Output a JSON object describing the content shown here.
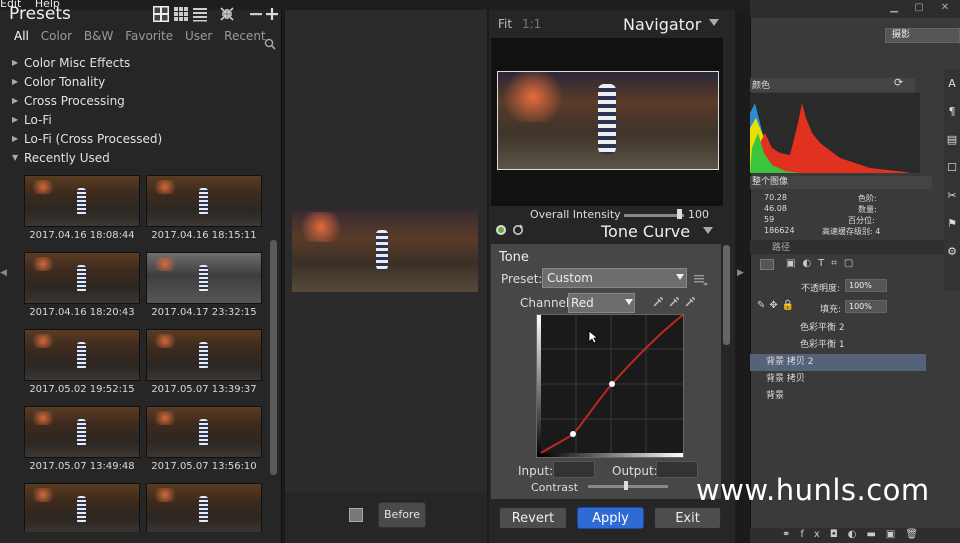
{
  "menu": [
    "Edit",
    "Help"
  ],
  "presets": {
    "title": "Presets",
    "tabs": [
      "All",
      "Color",
      "B&W",
      "Favorite",
      "User",
      "Recent"
    ],
    "groups": [
      {
        "label": "Color Misc Effects",
        "expanded": false
      },
      {
        "label": "Color Tonality",
        "expanded": false
      },
      {
        "label": "Cross Processing",
        "expanded": false
      },
      {
        "label": "Lo-Fi",
        "expanded": false
      },
      {
        "label": "Lo-Fi (Cross Processed)",
        "expanded": false
      },
      {
        "label": "Recently Used",
        "expanded": true
      }
    ],
    "thumbnails": [
      {
        "label": "2017.04.16 18:08:44",
        "bw": false
      },
      {
        "label": "2017.04.16 18:15:11",
        "bw": false
      },
      {
        "label": "2017.04.16 18:20:43",
        "bw": false
      },
      {
        "label": "2017.04.17 23:32:15",
        "bw": true
      },
      {
        "label": "2017.05.02 19:52:15",
        "bw": false
      },
      {
        "label": "2017.05.07 13:39:37",
        "bw": false
      },
      {
        "label": "2017.05.07 13:49:48",
        "bw": false
      },
      {
        "label": "2017.05.07 13:56:10",
        "bw": false
      },
      {
        "label": "",
        "bw": false
      },
      {
        "label": "",
        "bw": false
      }
    ]
  },
  "preview": {
    "before_label": "Before"
  },
  "navigator": {
    "fit": "Fit",
    "one_to_one": "1:1",
    "title": "Navigator"
  },
  "overall_intensity": {
    "label": "Overall Intensity",
    "value": "100"
  },
  "tone_curve": {
    "title": "Tone Curve",
    "section": "Tone",
    "preset_label": "Preset:",
    "preset_value": "Custom",
    "channel_label": "Channel:",
    "channel_value": "Red",
    "input_label": "Input:",
    "output_label": "Output:",
    "contrast_label": "Contrast",
    "curve_color": "#c0281e"
  },
  "footer": {
    "revert": "Revert",
    "apply": "Apply",
    "exit": "Exit"
  },
  "photoshop": {
    "workspace": "摄影",
    "histogram_channel": "颜色",
    "histogram_source": "整个图像",
    "stats": [
      {
        "label": "70.28",
        "label2": "色阶:"
      },
      {
        "label": "46.08",
        "label2": "数量:"
      },
      {
        "label": "59",
        "label2": "百分位:"
      },
      {
        "label": "186624",
        "label2": "高速缓存级别: 4"
      }
    ],
    "layers_tab": "路径",
    "opacity_label": "不透明度:",
    "opacity_value": "100%",
    "fill_label": "填充:",
    "fill_value": "100%",
    "layers": [
      {
        "name": "色彩平衡 2",
        "selected": false
      },
      {
        "name": "色彩平衡 1",
        "selected": false
      },
      {
        "name": "背景 拷贝 2",
        "selected": true
      },
      {
        "name": "背景 拷贝",
        "selected": false
      },
      {
        "name": "背景",
        "selected": false
      }
    ]
  },
  "watermark": "www.hunls.com"
}
